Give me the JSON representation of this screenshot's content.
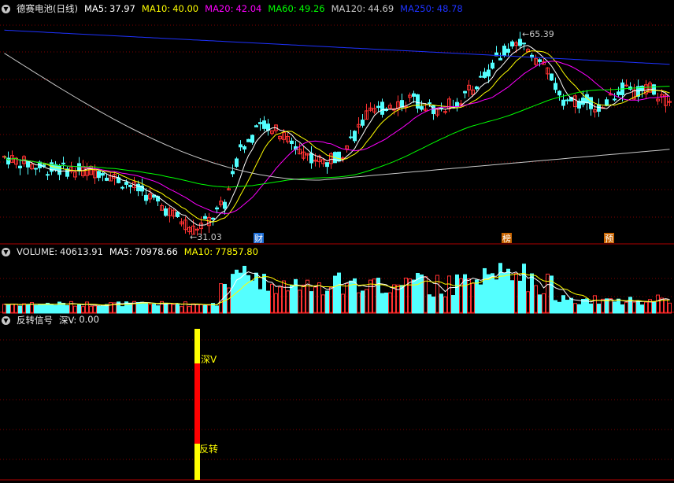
{
  "colors": {
    "bg": "#000000",
    "grid": "#800000",
    "up": "#ff3232",
    "down": "#54ffff",
    "ma5": "#ffffff",
    "ma10": "#ffff00",
    "ma20": "#ff00ff",
    "ma60": "#00ff00",
    "ma120": "#c8c8c8",
    "ma250": "#1e32ff",
    "signal_red": "#ff0000",
    "signal_yellow": "#ffff00"
  },
  "price_panel": {
    "title": "德赛电池(日线)",
    "ma_items": [
      {
        "label": "MA5:",
        "value": "37.97",
        "color": "#ffffff"
      },
      {
        "label": "MA10:",
        "value": "40.00",
        "color": "#ffff00"
      },
      {
        "label": "MA20:",
        "value": "42.04",
        "color": "#ff00ff"
      },
      {
        "label": "MA60:",
        "value": "49.26",
        "color": "#00ff00"
      },
      {
        "label": "MA120:",
        "value": "44.69",
        "color": "#c8c8c8"
      },
      {
        "label": "MA250:",
        "value": "48.78",
        "color": "#1e32ff"
      }
    ],
    "high_label": "65.39",
    "low_label": "31.03",
    "event_markers": [
      {
        "label": "财",
        "bar_index": 64
      },
      {
        "label": "榜",
        "bar_index": 127
      },
      {
        "label": "预",
        "bar_index": 153
      }
    ]
  },
  "volume_panel": {
    "title": "VOLUME:",
    "title_value": "40613.91",
    "ma_items": [
      {
        "label": "MA5:",
        "value": "70978.66",
        "color": "#ffffff"
      },
      {
        "label": "MA10:",
        "value": "77857.80",
        "color": "#ffff00"
      }
    ]
  },
  "signal_panel": {
    "title": "反转信号",
    "value_label": "深V:",
    "value": "0.00",
    "signal_labels": [
      "深V",
      "反转"
    ]
  },
  "chart_data": {
    "type": "candlestick",
    "series_count": 170,
    "price_range": [
      29.5,
      68.5
    ],
    "high": 65.39,
    "low": 31.03,
    "last_ma": {
      "MA5": 37.97,
      "MA10": 40.0,
      "MA20": 42.04,
      "MA60": 49.26,
      "MA120": 44.69,
      "MA250": 48.78
    },
    "last_volume": 40613.91,
    "volume_ma": {
      "MA5": 70978.66,
      "MA10": 77857.8
    },
    "signal": {
      "name": "深V",
      "bar_index": 50
    }
  }
}
